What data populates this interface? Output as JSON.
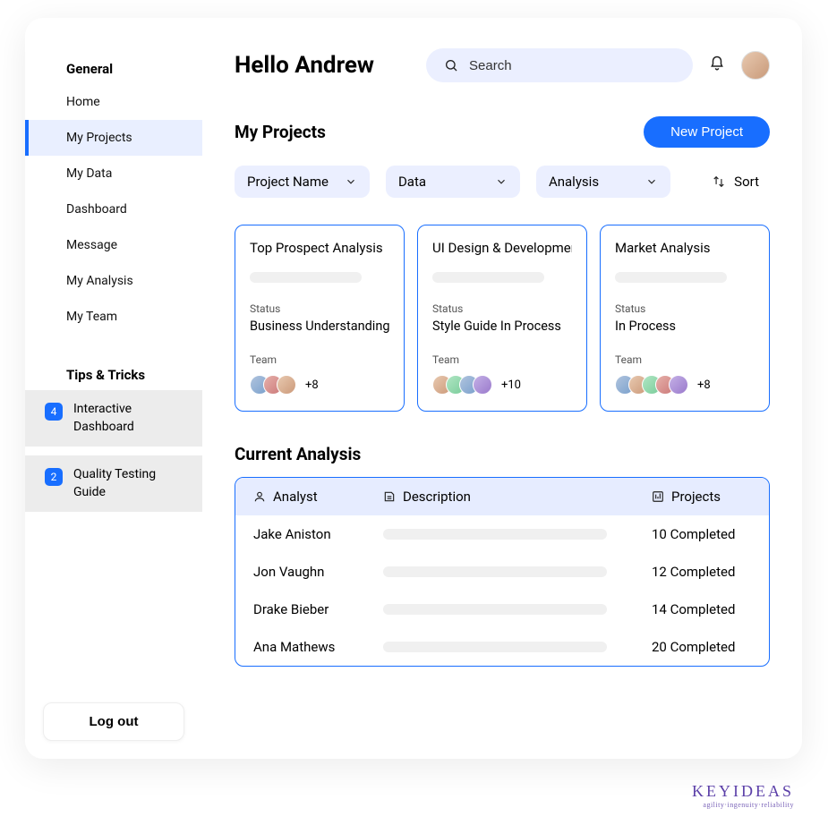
{
  "sidebar": {
    "general_header": "General",
    "items": [
      "Home",
      "My Projects",
      "My Data",
      "Dashboard",
      "Message",
      "My Analysis",
      "My Team"
    ],
    "active_index": 1,
    "tips_header": "Tips & Tricks",
    "tips": [
      {
        "badge": "4",
        "label": "Interactive Dashboard"
      },
      {
        "badge": "2",
        "label": "Quality Testing Guide"
      }
    ],
    "logout_label": "Log out"
  },
  "header": {
    "greeting": "Hello Andrew",
    "search_placeholder": "Search"
  },
  "projects": {
    "title": "My Projects",
    "new_button": "New Project",
    "filters": [
      {
        "label": "Project Name"
      },
      {
        "label": "Data"
      },
      {
        "label": "Analysis"
      }
    ],
    "sort_label": "Sort",
    "cards": [
      {
        "title": "Top Prospect Analysis",
        "status_label": "Status",
        "status_value": "Business Understanding",
        "team_label": "Team",
        "avatar_count": 3,
        "more": "+8"
      },
      {
        "title": "UI Design & Development",
        "status_label": "Status",
        "status_value": "Style Guide In Process",
        "team_label": "Team",
        "avatar_count": 4,
        "more": "+10"
      },
      {
        "title": "Market Analysis",
        "status_label": "Status",
        "status_value": "In Process",
        "team_label": "Team",
        "avatar_count": 5,
        "more": "+8"
      }
    ]
  },
  "analysis": {
    "title": "Current Analysis",
    "headers": {
      "analyst": "Analyst",
      "description": "Description",
      "projects": "Projects"
    },
    "rows": [
      {
        "analyst": "Jake Aniston",
        "projects": "10 Completed"
      },
      {
        "analyst": "Jon Vaughn",
        "projects": "12 Completed"
      },
      {
        "analyst": "Drake Bieber",
        "projects": "14 Completed"
      },
      {
        "analyst": "Ana Mathews",
        "projects": "20 Completed"
      }
    ]
  },
  "footer": {
    "brand": "KEYIDEAS",
    "tag": "agility·ingenuity·reliability"
  }
}
